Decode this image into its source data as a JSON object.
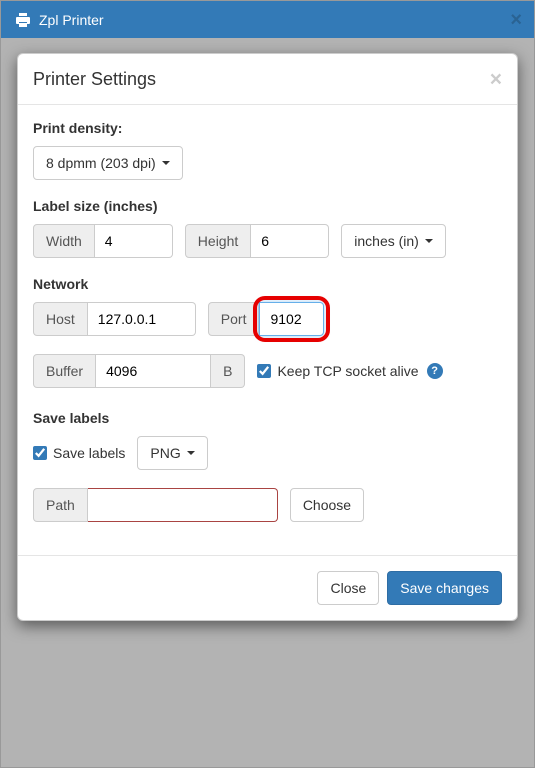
{
  "titlebar": {
    "appName": "Zpl Printer"
  },
  "modal": {
    "title": "Printer Settings",
    "density": {
      "label": "Print density:",
      "selected": "8 dpmm (203 dpi)"
    },
    "labelSize": {
      "label": "Label size (inches)",
      "widthLabel": "Width",
      "widthValue": "4",
      "heightLabel": "Height",
      "heightValue": "6",
      "unitSelected": "inches (in)"
    },
    "network": {
      "label": "Network",
      "hostLabel": "Host",
      "hostValue": "127.0.0.1",
      "portLabel": "Port",
      "portValue": "9102",
      "bufferLabel": "Buffer",
      "bufferValue": "4096",
      "bufferUnit": "B",
      "keepAliveLabel": "Keep TCP socket alive"
    },
    "save": {
      "label": "Save labels",
      "checkboxLabel": "Save labels",
      "formatSelected": "PNG",
      "pathLabel": "Path",
      "pathValue": "",
      "chooseLabel": "Choose"
    },
    "footer": {
      "closeLabel": "Close",
      "saveLabel": "Save changes"
    }
  }
}
